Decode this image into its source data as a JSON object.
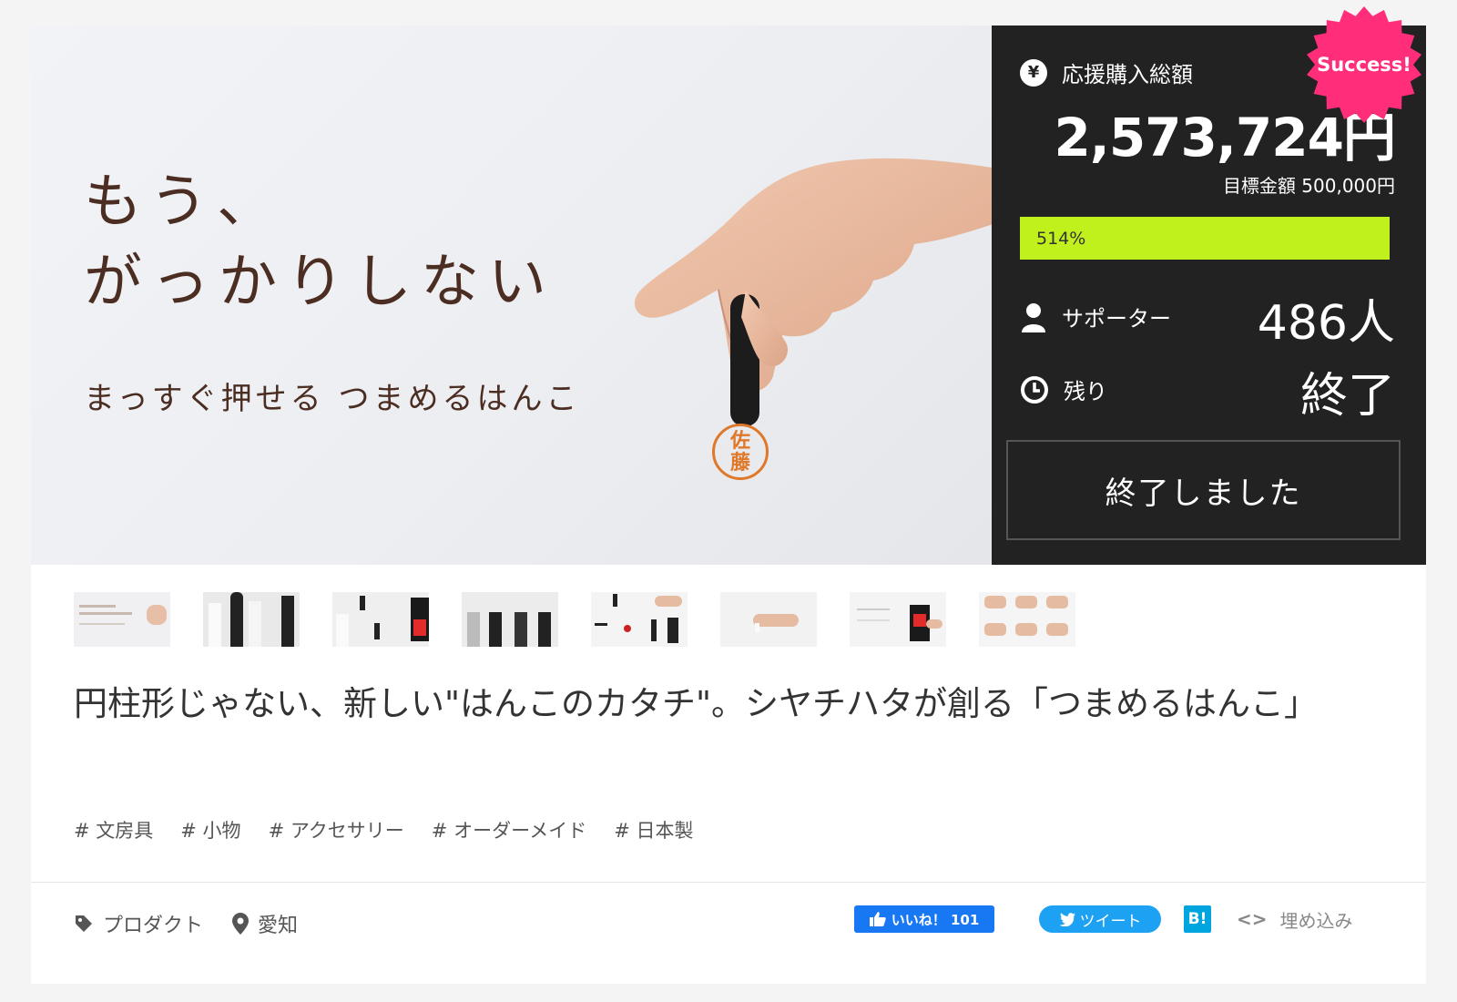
{
  "hero": {
    "title": "もう、\nがっかりしない",
    "subtitle": "まっすぐ押せる つまめるはんこ",
    "stamp_line1": "佐",
    "stamp_line2": "藤"
  },
  "panel": {
    "total_label": "応援購入総額",
    "total_value": "2,573,724円",
    "goal_text": "目標金額 500,000円",
    "progress_text": "514%",
    "progress_fraction": 1.0,
    "supporters_label": "サポーター",
    "supporters_value": "486人",
    "remaining_label": "残り",
    "remaining_value": "終了",
    "ended_button": "終了しました",
    "badge": "Success!",
    "yen_symbol": "¥"
  },
  "thumbnails": [
    "thumb-1",
    "thumb-2",
    "thumb-3",
    "thumb-4",
    "thumb-5",
    "thumb-6",
    "thumb-7",
    "thumb-8"
  ],
  "project_title": "円柱形じゃない、新しい\"はんこのカタチ\"。シヤチハタが創る「つまめるはんこ」",
  "tags": [
    "# 文房具",
    "# 小物",
    "# アクセサリー",
    "# オーダーメイド",
    "# 日本製"
  ],
  "footer": {
    "category": "プロダクト",
    "location": "愛知",
    "fb_label": "いいね！ 101",
    "tweet_label": "ツイート",
    "hatena_label": "B!",
    "embed_label": "埋め込み"
  },
  "colors": {
    "panel_bg": "#222222",
    "progress": "#c1f11c",
    "badge": "#ff2d7a",
    "facebook": "#1877f2",
    "twitter": "#1da1f2",
    "hatena": "#00a4de",
    "hero_text": "#4b2d22"
  }
}
